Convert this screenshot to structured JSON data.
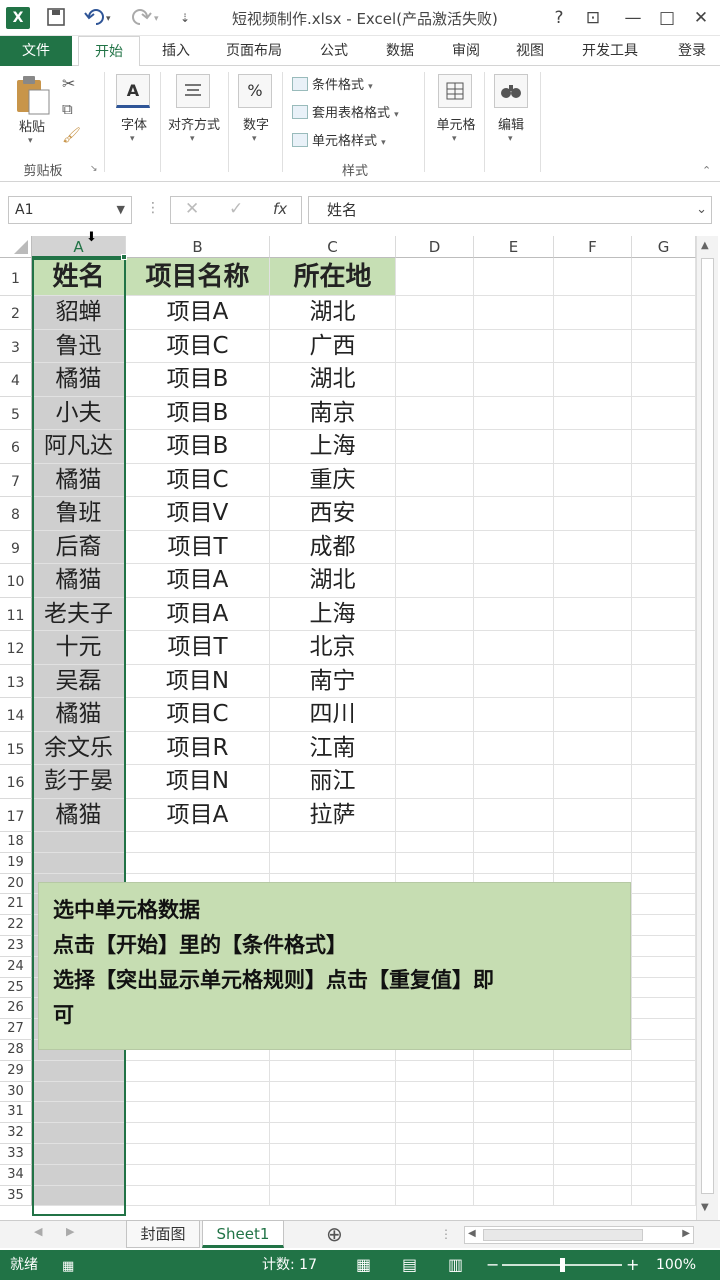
{
  "window": {
    "title": "短视频制作.xlsx - Excel(产品激活失败)",
    "app_icon": "X",
    "help": "?",
    "restore": "⊡",
    "minimize": "—",
    "maximize": "□",
    "close": "✕"
  },
  "tabs": {
    "file": "文件",
    "home": "开始",
    "insert": "插入",
    "page_layout": "页面布局",
    "formulas": "公式",
    "data": "数据",
    "review": "审阅",
    "view": "视图",
    "developer": "开发工具",
    "login": "登录"
  },
  "ribbon": {
    "paste": "粘贴",
    "clipboard": "剪贴板",
    "font": "字体",
    "font_icon": "A",
    "alignment": "对齐方式",
    "number": "数字",
    "number_icon": "%",
    "conditional_format": "条件格式",
    "table_format": "套用表格格式",
    "cell_styles": "单元格样式",
    "styles": "样式",
    "cells": "单元格",
    "editing": "编辑"
  },
  "formula_bar": {
    "name_box": "A1",
    "fx": "fx",
    "content": "姓名"
  },
  "columns": [
    "A",
    "B",
    "C",
    "D",
    "E",
    "F",
    "G"
  ],
  "rows": [
    {
      "num": "1",
      "a": "姓名",
      "b": "项目名称",
      "c": "所在地"
    },
    {
      "num": "2",
      "a": "貂蝉",
      "b": "项目A",
      "c": "湖北"
    },
    {
      "num": "3",
      "a": "鲁迅",
      "b": "项目C",
      "c": "广西"
    },
    {
      "num": "4",
      "a": "橘猫",
      "b": "项目B",
      "c": "湖北"
    },
    {
      "num": "5",
      "a": "小夫",
      "b": "项目B",
      "c": "南京"
    },
    {
      "num": "6",
      "a": "阿凡达",
      "b": "项目B",
      "c": "上海"
    },
    {
      "num": "7",
      "a": "橘猫",
      "b": "项目C",
      "c": "重庆"
    },
    {
      "num": "8",
      "a": "鲁班",
      "b": "项目V",
      "c": "西安"
    },
    {
      "num": "9",
      "a": "后裔",
      "b": "项目T",
      "c": "成都"
    },
    {
      "num": "10",
      "a": "橘猫",
      "b": "项目A",
      "c": "湖北"
    },
    {
      "num": "11",
      "a": "老夫子",
      "b": "项目A",
      "c": "上海"
    },
    {
      "num": "12",
      "a": "十元",
      "b": "项目T",
      "c": "北京"
    },
    {
      "num": "13",
      "a": "吴磊",
      "b": "项目N",
      "c": "南宁"
    },
    {
      "num": "14",
      "a": "橘猫",
      "b": "项目C",
      "c": "四川"
    },
    {
      "num": "15",
      "a": "余文乐",
      "b": "项目R",
      "c": "江南"
    },
    {
      "num": "16",
      "a": "彭于晏",
      "b": "项目N",
      "c": "丽江"
    },
    {
      "num": "17",
      "a": "橘猫",
      "b": "项目A",
      "c": "拉萨"
    }
  ],
  "empty_rows": [
    "18",
    "19",
    "20",
    "21",
    "22",
    "23",
    "24",
    "25",
    "26",
    "27",
    "28",
    "29",
    "30",
    "31",
    "32",
    "33",
    "34",
    "35"
  ],
  "note": {
    "line1": "选中单元格数据",
    "line2": "点击【开始】里的【条件格式】",
    "line3": "选择【突出显示单元格规则】点击【重复值】即",
    "line4": "可"
  },
  "sheets": {
    "tab1": "封面图",
    "tab2": "Sheet1",
    "add": "⊕"
  },
  "status": {
    "ready": "就绪",
    "count": "计数: 17",
    "zoom": "100%"
  },
  "colors": {
    "excel_green": "#217346",
    "header_fill": "#c6dfb4",
    "note_fill": "#c6ddb2"
  }
}
